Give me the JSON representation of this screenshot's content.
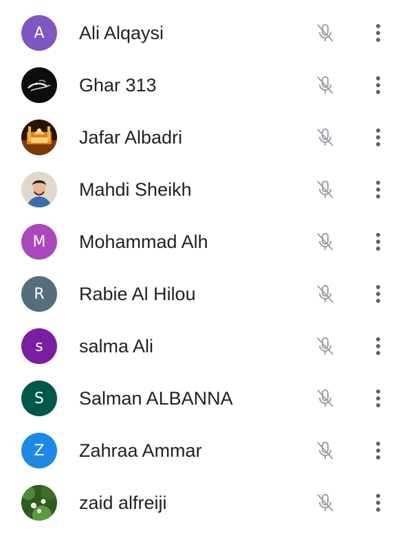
{
  "participants": [
    {
      "name": "Ali Alqaysi",
      "initial": "A",
      "avatar_type": "letter",
      "color": "#7e57c2",
      "mic_icon": "mic-off-icon",
      "menu_icon": "more-vert-icon"
    },
    {
      "name": "Ghar 313",
      "initial": "",
      "avatar_type": "photo",
      "color": "#111111",
      "mic_icon": "mic-off-icon",
      "menu_icon": "more-vert-icon"
    },
    {
      "name": "Jafar Albadri",
      "initial": "",
      "avatar_type": "photo",
      "color": "#5a2e0c",
      "mic_icon": "mic-off-icon",
      "menu_icon": "more-vert-icon"
    },
    {
      "name": "Mahdi Sheikh",
      "initial": "",
      "avatar_type": "photo",
      "color": "#d9d2c6",
      "mic_icon": "mic-off-icon",
      "menu_icon": "more-vert-icon"
    },
    {
      "name": "Mohammad Alh",
      "initial": "M",
      "avatar_type": "letter",
      "color": "#ab47bc",
      "mic_icon": "mic-off-icon",
      "menu_icon": "more-vert-icon"
    },
    {
      "name": "Rabie Al Hilou",
      "initial": "R",
      "avatar_type": "letter",
      "color": "#546e7a",
      "mic_icon": "mic-off-icon",
      "menu_icon": "more-vert-icon"
    },
    {
      "name": "salma Ali",
      "initial": "s",
      "avatar_type": "letter",
      "color": "#7b1fa2",
      "mic_icon": "mic-off-icon",
      "menu_icon": "more-vert-icon"
    },
    {
      "name": "Salman ALBANNA",
      "initial": "S",
      "avatar_type": "letter",
      "color": "#00574b",
      "mic_icon": "mic-off-icon",
      "menu_icon": "more-vert-icon"
    },
    {
      "name": "Zahraa Ammar",
      "initial": "Z",
      "avatar_type": "letter",
      "color": "#1e88e5",
      "mic_icon": "mic-off-icon",
      "menu_icon": "more-vert-icon"
    },
    {
      "name": "zaid alfreiji",
      "initial": "",
      "avatar_type": "photo",
      "color": "#3d6b2a",
      "mic_icon": "mic-off-icon",
      "menu_icon": "more-vert-icon"
    }
  ],
  "colors": {
    "name_text": "#202124",
    "icon": "#5f6368",
    "mic_off": "#9aa0a6"
  }
}
